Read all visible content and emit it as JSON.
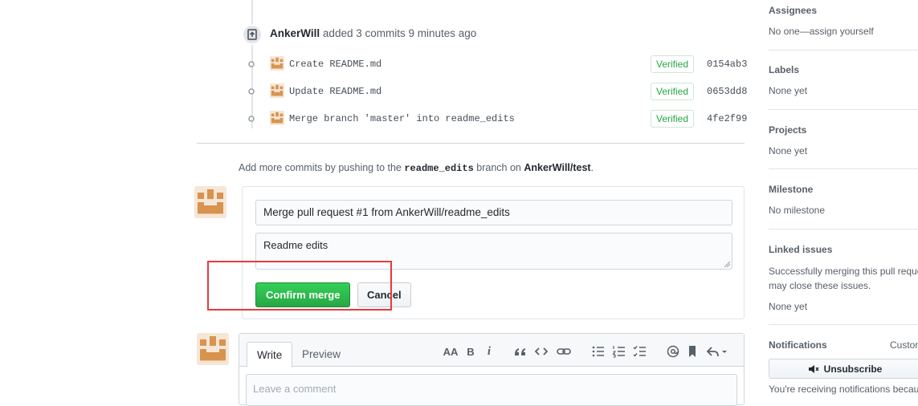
{
  "timeline": {
    "event": {
      "author": "AnkerWill",
      "action": "added 3 commits",
      "time": "9 minutes ago"
    },
    "commits": [
      {
        "message": "Create README.md",
        "badge": "Verified",
        "sha": "0154ab3"
      },
      {
        "message": "Update README.md",
        "badge": "Verified",
        "sha": "0653dd8"
      },
      {
        "message": "Merge branch 'master' into readme_edits",
        "badge": "Verified",
        "sha": "4fe2f99"
      }
    ]
  },
  "add_more": {
    "prefix": "Add more commits by pushing to the",
    "branch": "readme_edits",
    "middle": "branch on",
    "repo": "AnkerWill/test",
    "suffix": "."
  },
  "merge_form": {
    "title_value": "Merge pull request #1 from AnkerWill/readme_edits",
    "body_value": "Readme edits",
    "confirm_label": "Confirm merge",
    "cancel_label": "Cancel"
  },
  "comment": {
    "tab_write": "Write",
    "tab_preview": "Preview",
    "placeholder": "Leave a comment",
    "toolbar": {
      "heading": "AA",
      "bold": "B",
      "italic": "i"
    }
  },
  "sidebar": {
    "assignees": {
      "label": "Assignees",
      "value": "No one—assign yourself"
    },
    "labels": {
      "label": "Labels",
      "value": "None yet"
    },
    "projects": {
      "label": "Projects",
      "value": "None yet"
    },
    "milestone": {
      "label": "Milestone",
      "value": "No milestone"
    },
    "linked_issues": {
      "label": "Linked issues",
      "desc_line1": "Successfully merging this pull reque",
      "desc_line2": "may close these issues.",
      "value": "None yet"
    },
    "notifications": {
      "label": "Notifications",
      "customize": "Custor",
      "unsubscribe": "Unsubscribe",
      "note": "You're receiving notifications becau"
    }
  },
  "colors": {
    "primary_green": "#28a745",
    "highlight_red": "#e8393c",
    "avatar_tan": "#d8934f"
  }
}
